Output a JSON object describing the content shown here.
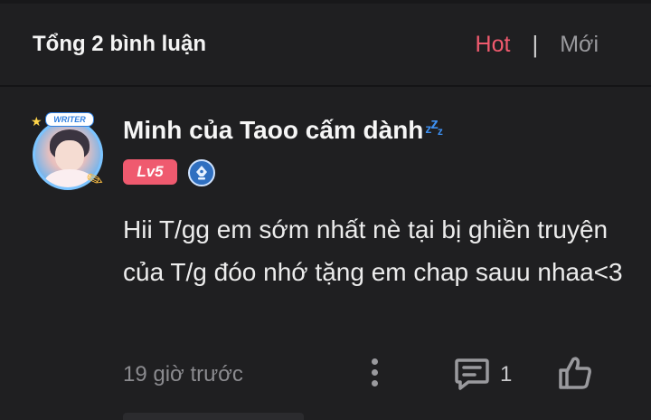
{
  "header": {
    "title": "Tổng 2 bình luận",
    "sort_hot": "Hot",
    "sort_separator": "|",
    "sort_new": "Mới"
  },
  "comment": {
    "username": "Minh của Taoo cấm dành",
    "avatar_frame_label": "WRITER",
    "level_badge": "Lv5",
    "content": "Hii T/gg em sớm nhất nè tại bị ghiền truyện của T/g đóo nhớ tặng em chap sauu nhaa<3",
    "time": "19 giờ trước",
    "reply_count": "1"
  },
  "icons": {
    "username_suffix": "zzz-icon",
    "writer_badge": "writer-pen-badge-icon",
    "more": "more-vertical-icon",
    "reply": "comment-icon",
    "like": "thumbs-up-icon"
  },
  "colors": {
    "background": "#1f1f21",
    "accent_hot": "#f05a6e",
    "level_badge": "#ef5a6f",
    "muted_text": "#8b8b8f",
    "writer_badge": "#2f6fc0"
  }
}
